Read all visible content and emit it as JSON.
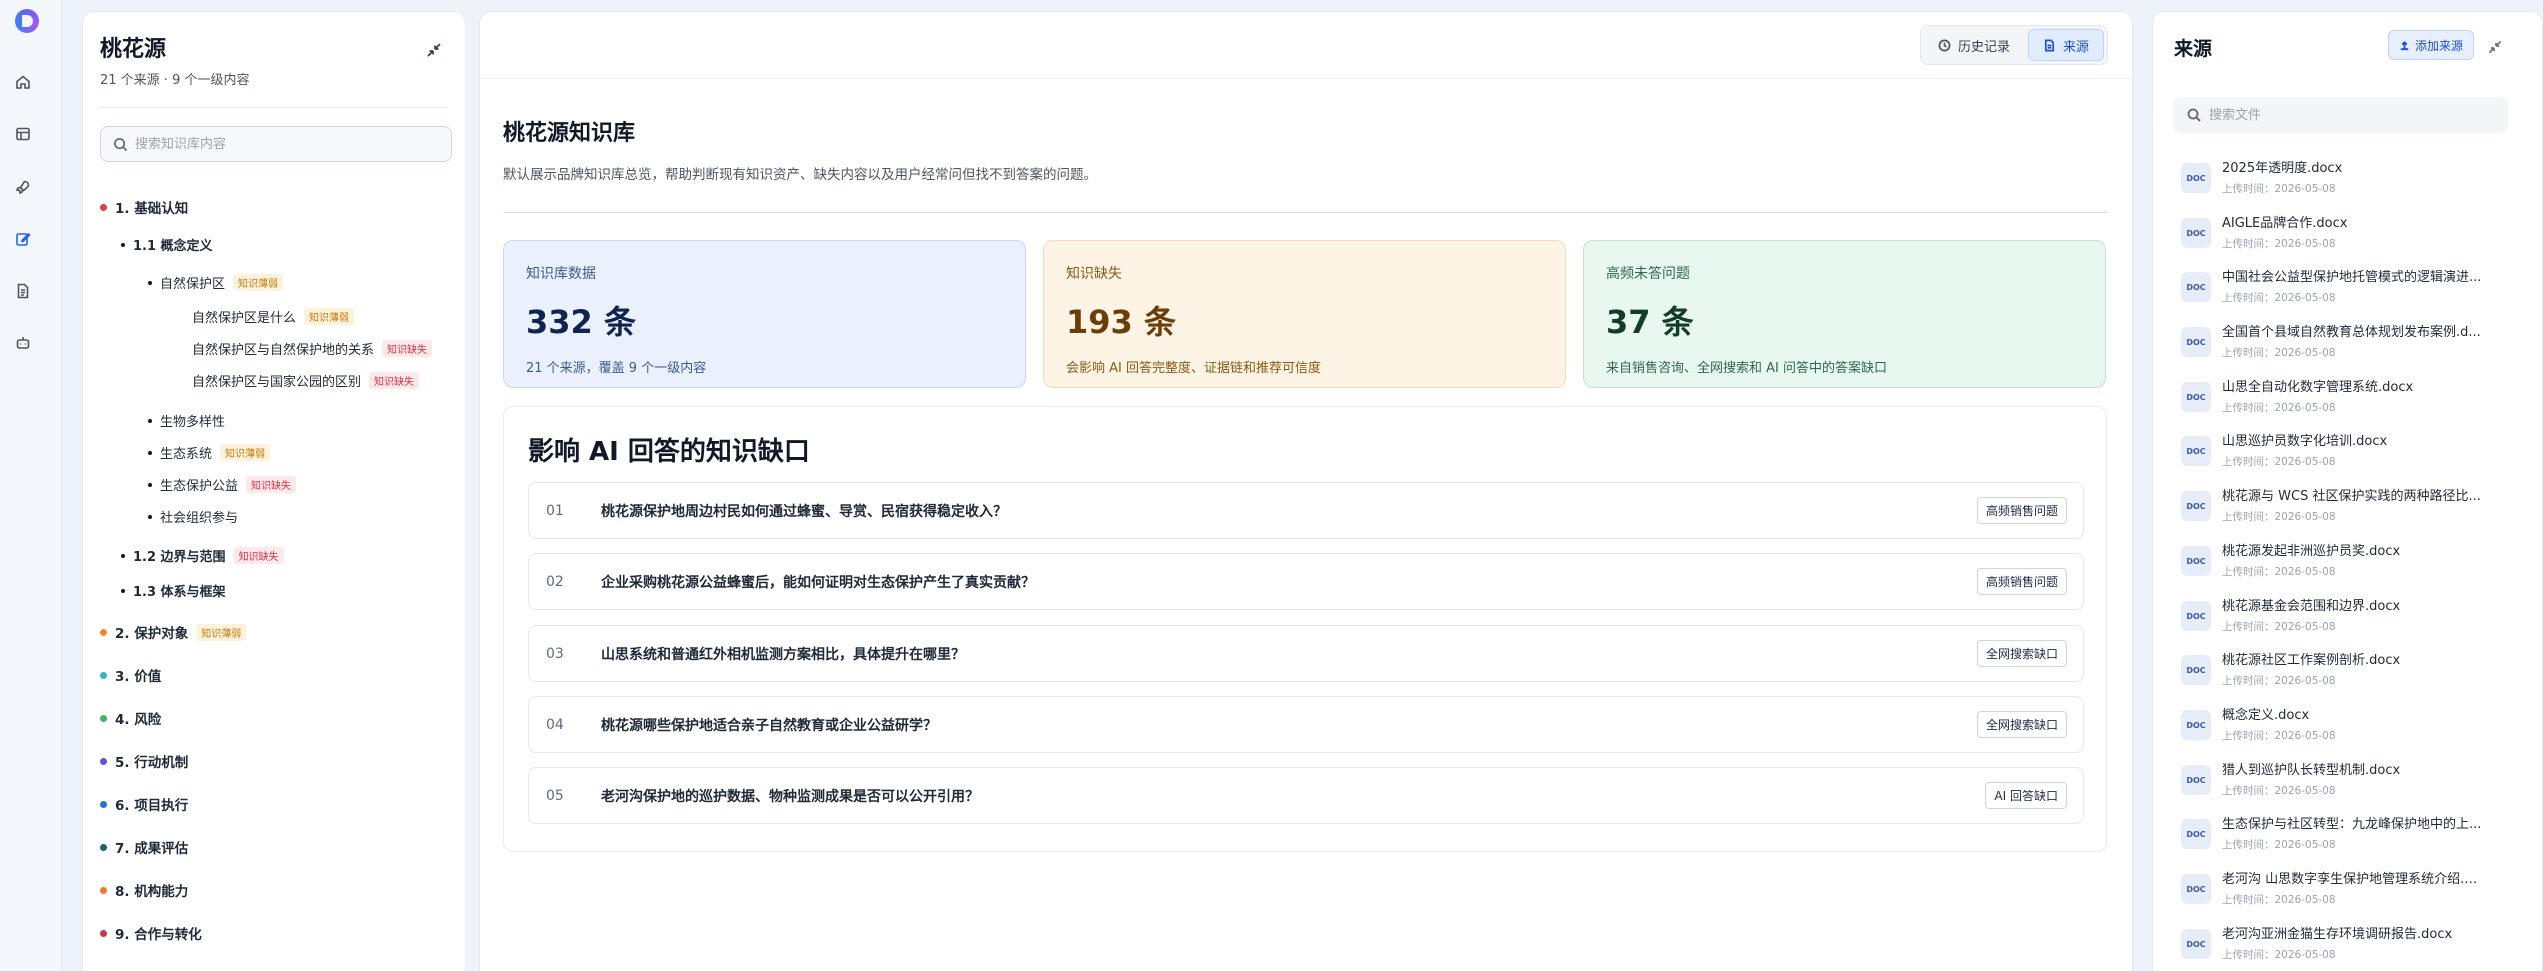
{
  "left": {
    "title": "桃花源",
    "subtitle": "21 个来源 · 9 个一级内容",
    "search_placeholder": "搜索知识库内容",
    "tree": [
      {
        "label": "1. 基础认知",
        "color": "#e23b4a",
        "tag": ""
      },
      {
        "label": "1.1 概念定义",
        "tag": ""
      },
      {
        "label": "自然保护区",
        "tag": "知识薄弱"
      },
      {
        "label": "自然保护区是什么",
        "tag": "知识薄弱"
      },
      {
        "label": "自然保护区与自然保护地的关系",
        "tag": "知识缺失"
      },
      {
        "label": "自然保护区与国家公园的区别",
        "tag": "知识缺失"
      },
      {
        "label": "生物多样性",
        "tag": ""
      },
      {
        "label": "生态系统",
        "tag": "知识薄弱"
      },
      {
        "label": "生态保护公益",
        "tag": "知识缺失"
      },
      {
        "label": "社会组织参与",
        "tag": ""
      },
      {
        "label": "1.2 边界与范围",
        "tag": "知识缺失"
      },
      {
        "label": "1.3 体系与框架",
        "tag": ""
      },
      {
        "label": "2. 保护对象",
        "color": "#f08a24",
        "tag": "知识薄弱"
      },
      {
        "label": "3. 价值",
        "color": "#36b3c9",
        "tag": ""
      },
      {
        "label": "4. 风险",
        "color": "#3fb56c",
        "tag": ""
      },
      {
        "label": "5. 行动机制",
        "color": "#6a4fe0",
        "tag": ""
      },
      {
        "label": "6. 项目执行",
        "color": "#2a6fd6",
        "tag": ""
      },
      {
        "label": "7. 成果评估",
        "color": "#14686e",
        "tag": ""
      },
      {
        "label": "8. 机构能力",
        "color": "#f0792a",
        "tag": ""
      },
      {
        "label": "9. 合作与转化",
        "color": "#d1304a",
        "tag": ""
      }
    ]
  },
  "main": {
    "tabs": [
      {
        "label": "历史记录"
      },
      {
        "label": "来源"
      }
    ],
    "title": "桃花源知识库",
    "description": "默认展示品牌知识库总览，帮助判断现有知识资产、缺失内容以及用户经常问但找不到答案的问题。",
    "stats": [
      {
        "label": "知识库数据",
        "value": "332 条",
        "desc": "21 个来源，覆盖 9 个一级内容"
      },
      {
        "label": "知识缺失",
        "value": "193 条",
        "desc": "会影响 AI 回答完整度、证据链和推荐可信度"
      },
      {
        "label": "高频未答问题",
        "value": "37 条",
        "desc": "来自销售咨询、全网搜索和 AI 问答中的答案缺口"
      }
    ],
    "gaps_title": "影响 AI 回答的知识缺口",
    "gaps": [
      {
        "num": "01",
        "question": "桃花源保护地周边村民如何通过蜂蜜、导赏、民宿获得稳定收入？",
        "tag": "高频销售问题"
      },
      {
        "num": "02",
        "question": "企业采购桃花源公益蜂蜜后，能如何证明对生态保护产生了真实贡献？",
        "tag": "高频销售问题"
      },
      {
        "num": "03",
        "question": "山思系统和普通红外相机监测方案相比，具体提升在哪里？",
        "tag": "全网搜索缺口"
      },
      {
        "num": "04",
        "question": "桃花源哪些保护地适合亲子自然教育或企业公益研学？",
        "tag": "全网搜索缺口"
      },
      {
        "num": "05",
        "question": "老河沟保护地的巡护数据、物种监测成果是否可以公开引用？",
        "tag": "AI 回答缺口"
      }
    ]
  },
  "right": {
    "title": "来源",
    "add_label": "添加来源",
    "search_placeholder": "搜索文件",
    "file_icon": "DOC",
    "files": [
      {
        "name": "2025年透明度.docx",
        "time": "上传时间：2026-05-08"
      },
      {
        "name": "AIGLE品牌合作.docx",
        "time": "上传时间：2026-05-08"
      },
      {
        "name": "中国社会公益型保护地托管模式的逻辑演进...",
        "time": "上传时间：2026-05-08"
      },
      {
        "name": "全国首个县域自然教育总体规划发布案例.d...",
        "time": "上传时间：2026-05-08"
      },
      {
        "name": "山思全自动化数字管理系统.docx",
        "time": "上传时间：2026-05-08"
      },
      {
        "name": "山思巡护员数字化培训.docx",
        "time": "上传时间：2026-05-08"
      },
      {
        "name": "桃花源与 WCS 社区保护实践的两种路径比...",
        "time": "上传时间：2026-05-08"
      },
      {
        "name": "桃花源发起非洲巡护员奖.docx",
        "time": "上传时间：2026-05-08"
      },
      {
        "name": "桃花源基金会范围和边界.docx",
        "time": "上传时间：2026-05-08"
      },
      {
        "name": "桃花源社区工作案例剖析.docx",
        "time": "上传时间：2026-05-08"
      },
      {
        "name": "概念定义.docx",
        "time": "上传时间：2026-05-08"
      },
      {
        "name": "猎人到巡护队长转型机制.docx",
        "time": "上传时间：2026-05-08"
      },
      {
        "name": "生态保护与社区转型：九龙峰保护地中的上...",
        "time": "上传时间：2026-05-08"
      },
      {
        "name": "老河沟 山思数字孪生保护地管理系统介绍.d...",
        "time": "上传时间：2026-05-08"
      },
      {
        "name": "老河沟亚洲金猫生存环境调研报告.docx",
        "time": "上传时间：2026-05-08"
      }
    ]
  }
}
